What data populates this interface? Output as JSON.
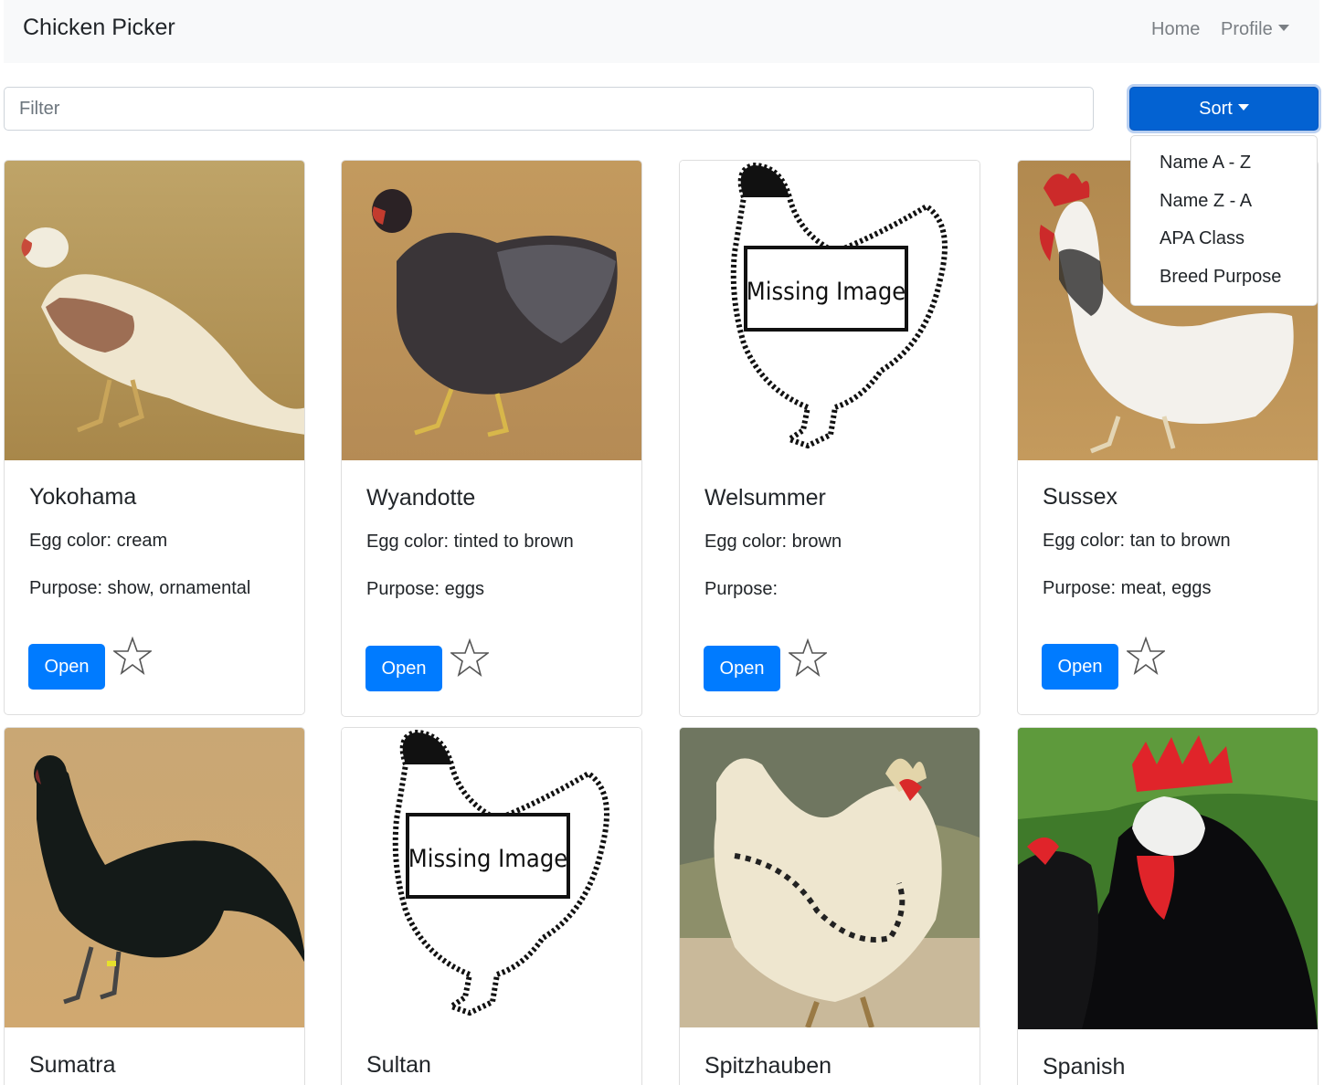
{
  "navbar": {
    "brand": "Chicken Picker",
    "home": "Home",
    "profile": "Profile"
  },
  "filter": {
    "placeholder": "Filter",
    "value": ""
  },
  "sort": {
    "label": "Sort",
    "options": [
      "Name A - Z",
      "Name Z - A",
      "APA Class",
      "Breed Purpose"
    ]
  },
  "cards": [
    {
      "name": "Yokohama",
      "egg": "Egg color: cream",
      "purpose": "Purpose: show, ornamental",
      "open": "Open",
      "image": "photo"
    },
    {
      "name": "Wyandotte",
      "egg": "Egg color: tinted to brown",
      "purpose": "Purpose: eggs",
      "open": "Open",
      "image": "photo"
    },
    {
      "name": "Welsummer",
      "egg": "Egg color: brown",
      "purpose": "Purpose:",
      "open": "Open",
      "image": "missing",
      "missing_label": "Missing Image"
    },
    {
      "name": "Sussex",
      "egg": "Egg color: tan to brown",
      "purpose": "Purpose: meat, eggs",
      "open": "Open",
      "image": "photo"
    },
    {
      "name": "Sumatra",
      "image": "photo"
    },
    {
      "name": "Sultan",
      "image": "missing",
      "missing_label": "Missing Image"
    },
    {
      "name": "Spitzhauben",
      "image": "photo"
    },
    {
      "name": "Spanish",
      "image": "photo"
    }
  ],
  "icons": {
    "favorite": "star-outline-icon",
    "dropdown": "caret-down-icon"
  },
  "colors": {
    "primary": "#007bff",
    "sort_active": "#0362d2",
    "navbar_bg": "#f8f9fa"
  }
}
